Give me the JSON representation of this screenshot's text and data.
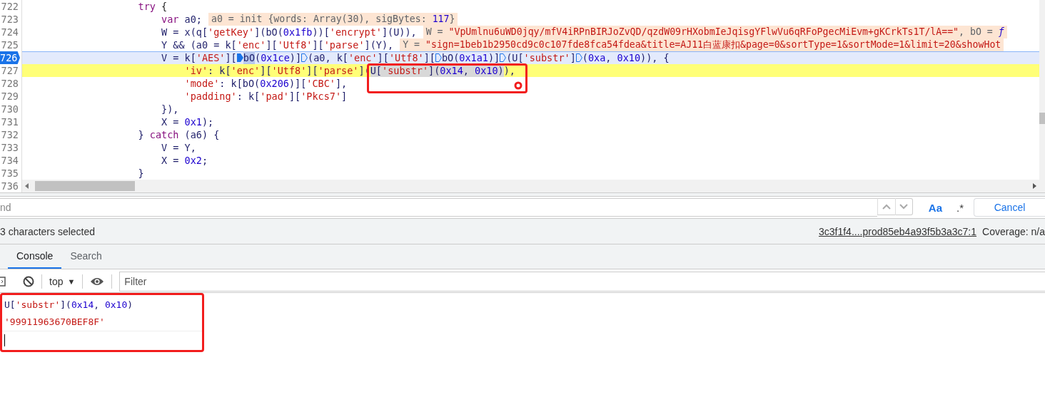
{
  "code": {
    "callout": true,
    "lines": [
      {
        "number": "722",
        "paused": false,
        "matched": false,
        "breakpoint": false,
        "tokens": [
          {
            "text": "                    try",
            "kind": "kw",
            "selected": false
          },
          {
            "text": " {",
            "kind": "plain",
            "selected": false
          }
        ]
      },
      {
        "number": "723",
        "paused": false,
        "matched": false,
        "breakpoint": false,
        "tokens": [
          {
            "text": "                        var",
            "kind": "kw",
            "selected": false
          },
          {
            "text": " a0;",
            "kind": "ident",
            "selected": false
          }
        ],
        "inline_value": [
          {
            "text": "a0 = init ",
            "kind": "label"
          },
          {
            "text": "{words: Array(30), sigBytes: ",
            "kind": "label"
          },
          {
            "text": "117",
            "kind": "num"
          },
          {
            "text": "}",
            "kind": "label"
          }
        ]
      },
      {
        "number": "724",
        "paused": false,
        "matched": false,
        "breakpoint": false,
        "tokens": [
          {
            "text": "                        W = x(q[",
            "kind": "ident",
            "selected": false
          },
          {
            "text": "'getKey'",
            "kind": "str",
            "selected": false
          },
          {
            "text": "](bO(",
            "kind": "ident",
            "selected": false
          },
          {
            "text": "0x1fb",
            "kind": "num",
            "selected": false
          },
          {
            "text": "))[",
            "kind": "ident",
            "selected": false
          },
          {
            "text": "'encrypt'",
            "kind": "str",
            "selected": false
          },
          {
            "text": "](U)),",
            "kind": "ident",
            "selected": false
          }
        ],
        "inline_value": [
          {
            "text": "W = ",
            "kind": "label"
          },
          {
            "text": "\"VpUmlnu6uWD0jqy/mfV4iRPnBIRJoZvQD/qzdW09rHXobmIeJqisgYFlwVu6qRFoPgecMiEvm+gKCrkTs1T/lA==\"",
            "kind": "str"
          },
          {
            "text": ", bO = ",
            "kind": "label"
          },
          {
            "text": "ƒ",
            "kind": "fn"
          }
        ]
      },
      {
        "number": "725",
        "paused": false,
        "matched": false,
        "breakpoint": false,
        "tokens": [
          {
            "text": "                        Y && (a0 = k[",
            "kind": "ident",
            "selected": false
          },
          {
            "text": "'enc'",
            "kind": "str",
            "selected": false
          },
          {
            "text": "][",
            "kind": "ident",
            "selected": false
          },
          {
            "text": "'Utf8'",
            "kind": "str",
            "selected": false
          },
          {
            "text": "][",
            "kind": "ident",
            "selected": false
          },
          {
            "text": "'parse'",
            "kind": "str",
            "selected": false
          },
          {
            "text": "](Y),",
            "kind": "ident",
            "selected": false
          }
        ],
        "inline_value": [
          {
            "text": "Y = ",
            "kind": "label"
          },
          {
            "text": "\"sign=1beb1b2950cd9c0c107fde8fca54fdea&title=AJ11白蓝康扣&page=0&sortType=1&sortMode=1&limit=20&showHot",
            "kind": "str"
          }
        ]
      },
      {
        "number": "726",
        "paused": true,
        "matched": false,
        "breakpoint": true,
        "tokens": [
          {
            "text": "                        V = k[",
            "kind": "ident",
            "selected": false
          },
          {
            "text": "'AES'",
            "kind": "str",
            "selected": false
          },
          {
            "text": "][",
            "kind": "ident",
            "selected": false
          },
          {
            "kind": "marker",
            "active": true
          },
          {
            "text": "bO",
            "kind": "ident",
            "selected": true
          },
          {
            "text": "(",
            "kind": "ident",
            "selected": false
          },
          {
            "text": "0x1ce",
            "kind": "num",
            "selected": false
          },
          {
            "text": ")]",
            "kind": "ident",
            "selected": false
          },
          {
            "kind": "marker",
            "active": false
          },
          {
            "text": "(a0, k[",
            "kind": "ident",
            "selected": false
          },
          {
            "text": "'enc'",
            "kind": "str",
            "selected": false
          },
          {
            "text": "][",
            "kind": "ident",
            "selected": false
          },
          {
            "text": "'Utf8'",
            "kind": "str",
            "selected": false
          },
          {
            "text": "][",
            "kind": "ident",
            "selected": false
          },
          {
            "kind": "marker",
            "active": false
          },
          {
            "text": "bO(",
            "kind": "ident",
            "selected": false
          },
          {
            "text": "0x1a1",
            "kind": "num",
            "selected": false
          },
          {
            "text": ")]",
            "kind": "ident",
            "selected": false
          },
          {
            "kind": "marker",
            "active": false
          },
          {
            "text": "(U[",
            "kind": "ident",
            "selected": false
          },
          {
            "text": "'substr'",
            "kind": "str",
            "selected": false
          },
          {
            "text": "]",
            "kind": "ident",
            "selected": false
          },
          {
            "kind": "marker",
            "active": false
          },
          {
            "text": "(",
            "kind": "ident",
            "selected": false
          },
          {
            "text": "0xa",
            "kind": "num",
            "selected": false
          },
          {
            "text": ", ",
            "kind": "ident",
            "selected": false
          },
          {
            "text": "0x10",
            "kind": "num",
            "selected": false
          },
          {
            "text": ")), {",
            "kind": "ident",
            "selected": false
          }
        ]
      },
      {
        "number": "727",
        "paused": false,
        "matched": true,
        "breakpoint": false,
        "tokens": [
          {
            "text": "                            'iv'",
            "kind": "str",
            "selected": false
          },
          {
            "text": ": k[",
            "kind": "ident",
            "selected": false
          },
          {
            "text": "'enc'",
            "kind": "str",
            "selected": false
          },
          {
            "text": "][",
            "kind": "ident",
            "selected": false
          },
          {
            "text": "'Utf8'",
            "kind": "str",
            "selected": false
          },
          {
            "text": "][",
            "kind": "ident",
            "selected": false
          },
          {
            "text": "'parse'",
            "kind": "str",
            "selected": false
          },
          {
            "text": "](",
            "kind": "ident",
            "selected": false
          },
          {
            "text": "U[",
            "kind": "ident",
            "selected": true
          },
          {
            "text": "'substr'",
            "kind": "str",
            "selected": true
          },
          {
            "text": "](",
            "kind": "ident",
            "selected": true
          },
          {
            "text": "0x14",
            "kind": "num",
            "selected": true
          },
          {
            "text": ", ",
            "kind": "ident",
            "selected": true
          },
          {
            "text": "0x10",
            "kind": "num",
            "selected": true
          },
          {
            "text": ")",
            "kind": "ident",
            "selected": true
          },
          {
            "text": "),",
            "kind": "ident",
            "selected": false
          }
        ]
      },
      {
        "number": "728",
        "paused": false,
        "matched": false,
        "breakpoint": false,
        "tokens": [
          {
            "text": "                            'mode'",
            "kind": "str",
            "selected": false
          },
          {
            "text": ": k[bO(",
            "kind": "ident",
            "selected": false
          },
          {
            "text": "0x206",
            "kind": "num",
            "selected": false
          },
          {
            "text": ")][",
            "kind": "ident",
            "selected": false
          },
          {
            "text": "'CBC'",
            "kind": "str",
            "selected": false
          },
          {
            "text": "],",
            "kind": "ident",
            "selected": false
          }
        ]
      },
      {
        "number": "729",
        "paused": false,
        "matched": false,
        "breakpoint": false,
        "tokens": [
          {
            "text": "                            'padding'",
            "kind": "str",
            "selected": false
          },
          {
            "text": ": k[",
            "kind": "ident",
            "selected": false
          },
          {
            "text": "'pad'",
            "kind": "str",
            "selected": false
          },
          {
            "text": "][",
            "kind": "ident",
            "selected": false
          },
          {
            "text": "'Pkcs7'",
            "kind": "str",
            "selected": false
          },
          {
            "text": "]",
            "kind": "ident",
            "selected": false
          }
        ]
      },
      {
        "number": "730",
        "paused": false,
        "matched": false,
        "breakpoint": false,
        "tokens": [
          {
            "text": "                        }),",
            "kind": "ident",
            "selected": false
          }
        ]
      },
      {
        "number": "731",
        "paused": false,
        "matched": false,
        "breakpoint": false,
        "tokens": [
          {
            "text": "                        X = ",
            "kind": "ident",
            "selected": false
          },
          {
            "text": "0x1",
            "kind": "num",
            "selected": false
          },
          {
            "text": ");",
            "kind": "ident",
            "selected": false
          }
        ]
      },
      {
        "number": "732",
        "paused": false,
        "matched": false,
        "breakpoint": false,
        "tokens": [
          {
            "text": "                    } ",
            "kind": "ident",
            "selected": false
          },
          {
            "text": "catch",
            "kind": "kw",
            "selected": false
          },
          {
            "text": " (a6) {",
            "kind": "ident",
            "selected": false
          }
        ]
      },
      {
        "number": "733",
        "paused": false,
        "matched": false,
        "breakpoint": false,
        "tokens": [
          {
            "text": "                        V = Y,",
            "kind": "ident",
            "selected": false
          }
        ]
      },
      {
        "number": "734",
        "paused": false,
        "matched": false,
        "breakpoint": false,
        "tokens": [
          {
            "text": "                        X = ",
            "kind": "ident",
            "selected": false
          },
          {
            "text": "0x2",
            "kind": "num",
            "selected": false
          },
          {
            "text": ";",
            "kind": "ident",
            "selected": false
          }
        ]
      },
      {
        "number": "735",
        "paused": false,
        "matched": false,
        "breakpoint": false,
        "tokens": [
          {
            "text": "                    }",
            "kind": "ident",
            "selected": false
          }
        ]
      },
      {
        "number": "736",
        "breakpoint": false
      }
    ]
  },
  "find_bar": {
    "placeholder": "nd",
    "match_case": "Aa",
    "regex": ".*",
    "cancel": "Cancel"
  },
  "status_bar": {
    "selection": "3 characters selected",
    "source_link": "3c3f1f4....prod85eb4a93f5b3a3c7:1",
    "coverage": "Coverage: n/a"
  },
  "drawer_tabs": [
    {
      "label": "Console",
      "selected": true
    },
    {
      "label": "Search",
      "selected": false
    }
  ],
  "console_toolbar": {
    "context": "top",
    "context_caret": "▼",
    "filter_placeholder": "Filter"
  },
  "console": {
    "callout": true,
    "entries": [
      {
        "kind": "input",
        "tokens": [
          {
            "text": "U[",
            "kind": "ident"
          },
          {
            "text": "'substr'",
            "kind": "str"
          },
          {
            "text": "](",
            "kind": "ident"
          },
          {
            "text": "0x14",
            "kind": "num"
          },
          {
            "text": ", ",
            "kind": "ident"
          },
          {
            "text": "0x10",
            "kind": "num"
          },
          {
            "text": ")",
            "kind": "ident"
          }
        ]
      },
      {
        "kind": "result",
        "tokens": [
          {
            "text": "'99911963670BEF8F'",
            "kind": "str"
          }
        ]
      },
      {
        "kind": "prompt"
      }
    ]
  }
}
